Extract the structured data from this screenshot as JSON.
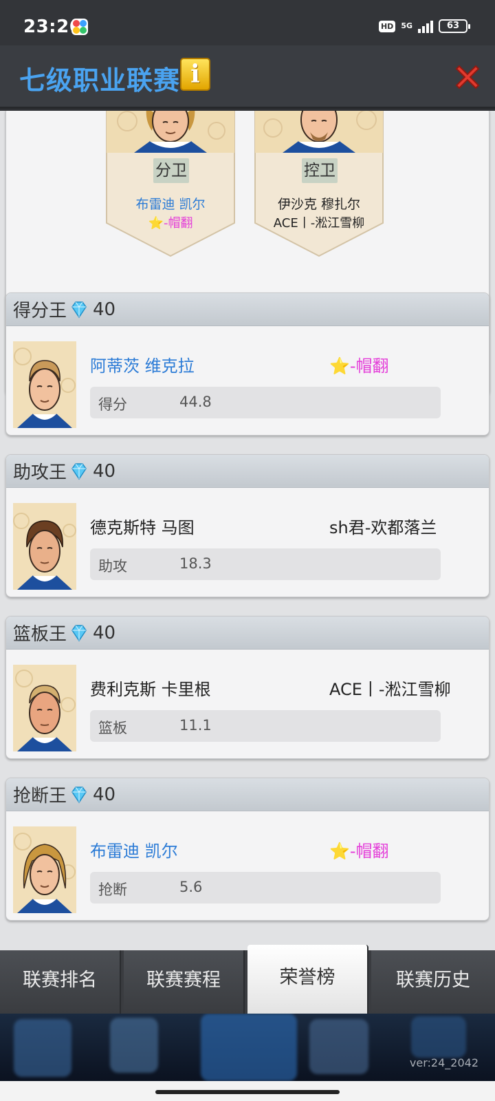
{
  "status_bar": {
    "time": "23:26",
    "hd": "HD",
    "network": "5G",
    "battery": "63"
  },
  "header": {
    "title": "七级职业联赛",
    "info_icon": "info-icon",
    "close_icon": "close-icon"
  },
  "positions": [
    {
      "position": "分卫",
      "player": "布雷迪 凯尔",
      "team_star": "⭐",
      "team": "-帽翻"
    },
    {
      "position": "控卫",
      "player": "伊沙克 穆扎尔",
      "team_star": "",
      "team": "ACE丨-淞江雪柳"
    }
  ],
  "awards": [
    {
      "title": "得分王",
      "reward": "40",
      "player": "阿蒂茨 维克拉",
      "team_star": "⭐",
      "team": "-帽翻",
      "stat_label": "得分",
      "stat_value": "44.8",
      "highlight": true
    },
    {
      "title": "助攻王",
      "reward": "40",
      "player": "德克斯特 马图",
      "team_star": "",
      "team": "sh君-欢都落兰",
      "stat_label": "助攻",
      "stat_value": "18.3",
      "highlight": false
    },
    {
      "title": "篮板王",
      "reward": "40",
      "player": "费利克斯 卡里根",
      "team_star": "",
      "team": "ACE丨-淞江雪柳",
      "stat_label": "篮板",
      "stat_value": "11.1",
      "highlight": false
    },
    {
      "title": "抢断王",
      "reward": "40",
      "player": "布雷迪 凯尔",
      "team_star": "⭐",
      "team": "-帽翻",
      "stat_label": "抢断",
      "stat_value": "5.6",
      "highlight": true
    }
  ],
  "tabs": [
    {
      "label": "联赛排名",
      "active": false
    },
    {
      "label": "联赛赛程",
      "active": false
    },
    {
      "label": "荣誉榜",
      "active": true
    },
    {
      "label": "联赛历史",
      "active": false
    }
  ],
  "version": "ver:24_2042",
  "colors": {
    "title_blue": "#4aa3f0",
    "player_blue": "#2b7bd6",
    "team_pink": "#e43fd9",
    "star_yellow": "#f7c21b"
  }
}
